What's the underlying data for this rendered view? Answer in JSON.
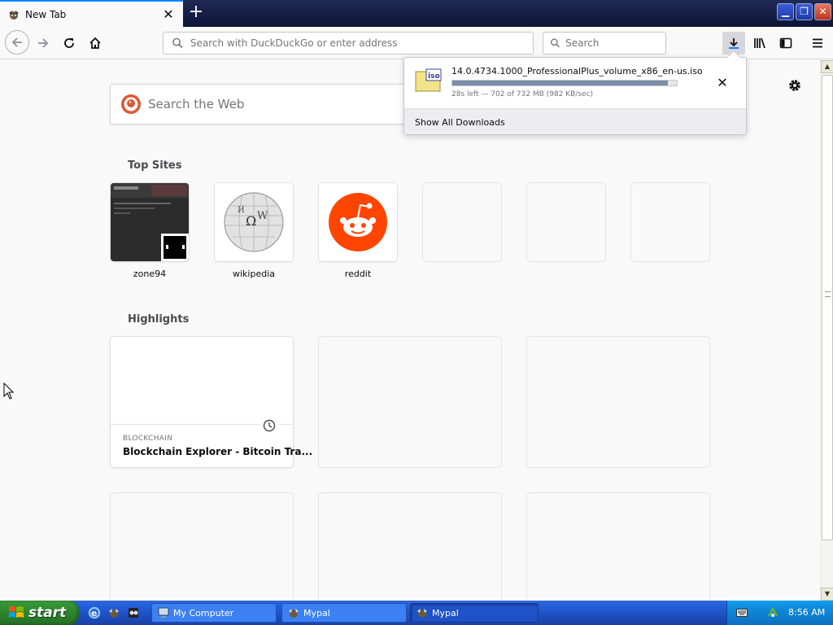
{
  "browser": {
    "tab": {
      "title": "New Tab",
      "favicon": "mypal-icon"
    },
    "window_controls": {
      "minimize": "minimize-icon",
      "maximize": "restore-icon",
      "close": "close-icon"
    },
    "urlbar": {
      "placeholder": "Search with DuckDuckGo or enter address"
    },
    "searchbar": {
      "placeholder": "Search"
    }
  },
  "newtab": {
    "websearch": {
      "placeholder": "Search the Web"
    },
    "top_sites": {
      "title": "Top Sites",
      "items": [
        {
          "label": "zone94"
        },
        {
          "label": "wikipedia"
        },
        {
          "label": "reddit"
        }
      ]
    },
    "highlights": {
      "title": "Highlights",
      "card": {
        "context": "BLOCKCHAIN",
        "title": "Blockchain Explorer - Bitcoin Tra..."
      }
    }
  },
  "download": {
    "filename": "14.0.4734.1000_ProfessionalPlus_volume_x86_en-us.iso",
    "status": "28s left — 702 of 732 MB (982 KB/sec)",
    "progress_fraction": 0.959,
    "file_badge": "iso",
    "show_all": "Show All Downloads"
  },
  "taskbar": {
    "start_label": "start",
    "tasks": [
      {
        "label": "My Computer"
      },
      {
        "label": "Mypal"
      },
      {
        "label": "Mypal"
      }
    ],
    "clock": "8:56 AM"
  },
  "colors": {
    "accent": "#0a84ff",
    "reddit": "#ff4500",
    "progress": "#7a8ea8",
    "xp_taskbar": "#245edb"
  }
}
